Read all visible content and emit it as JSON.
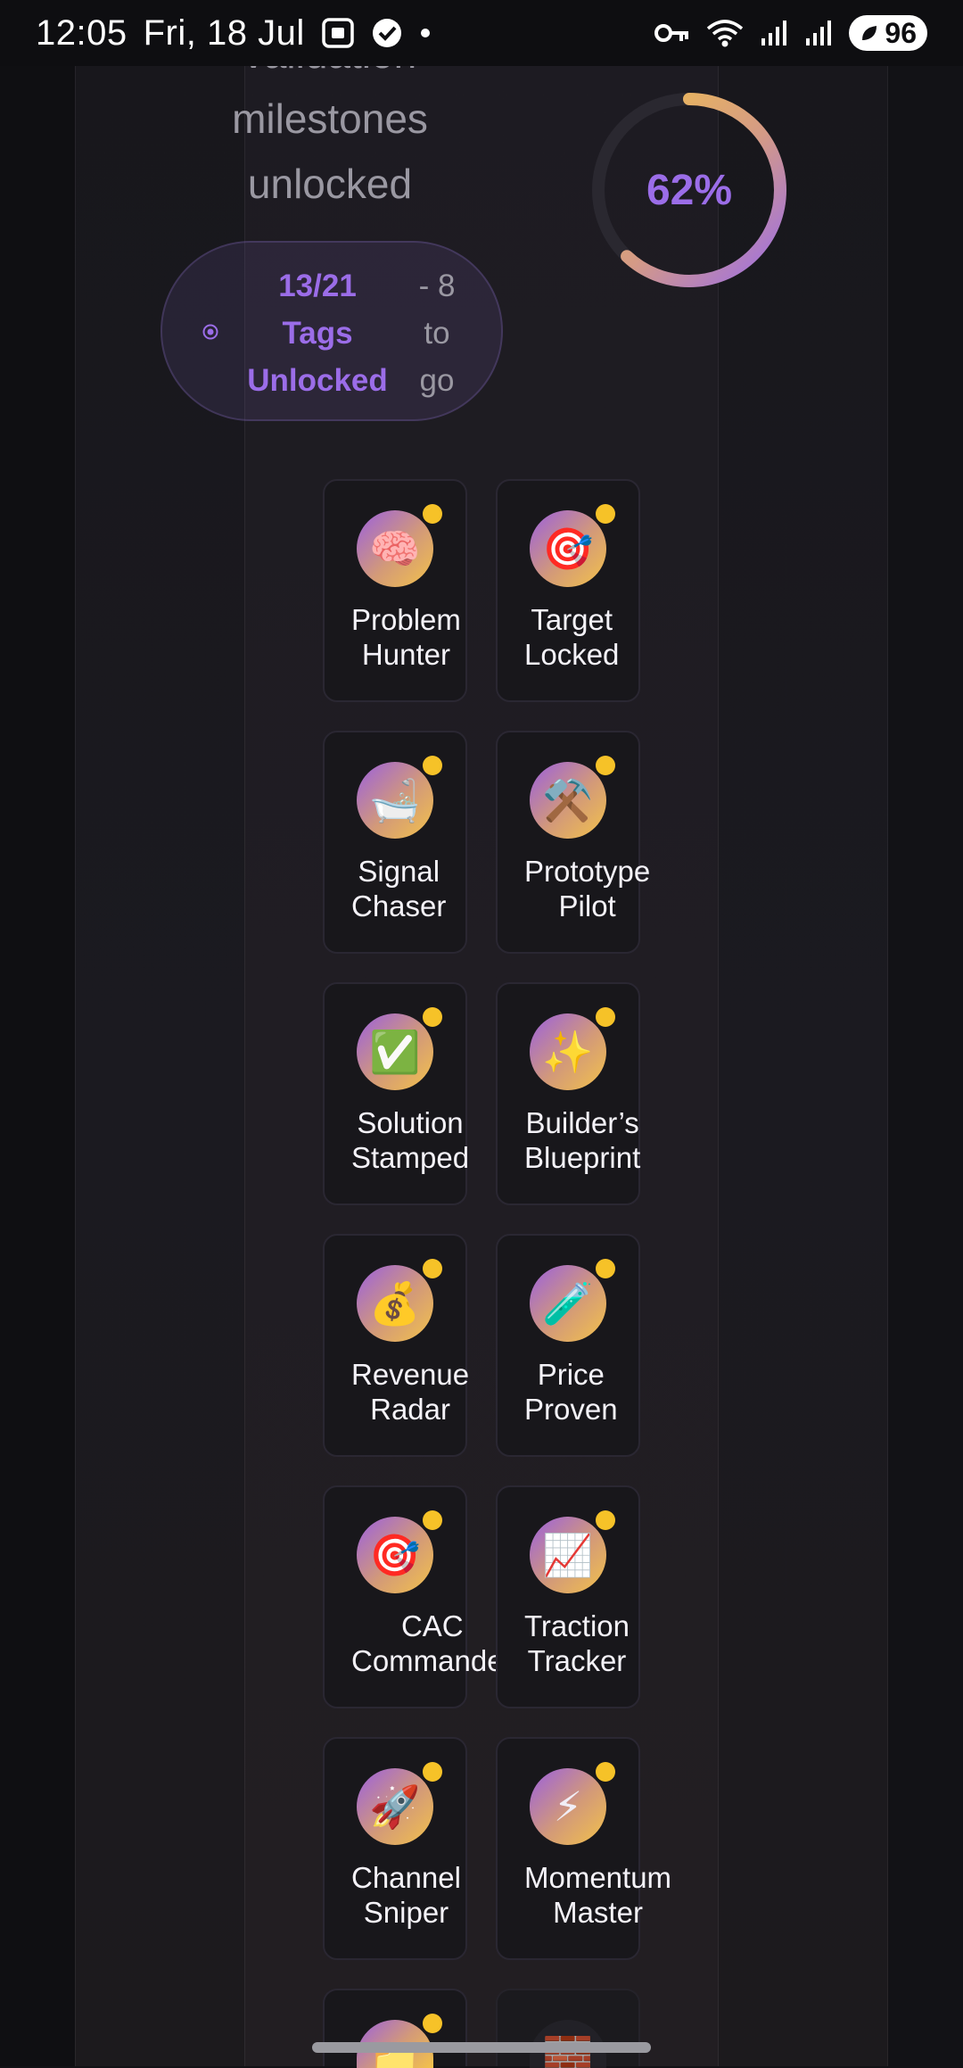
{
  "status_bar": {
    "time": "12:05",
    "date": "Fri, 18 Jul",
    "battery": "96",
    "icons": [
      "screenshot-icon",
      "check-badge-icon",
      "dot-icon",
      "vpn-key-icon",
      "wifi-icon",
      "signal-icon",
      "signal-icon-2",
      "battery-icon"
    ]
  },
  "header": {
    "caption_lines": [
      "validation",
      "milestones",
      "unlocked"
    ],
    "progress_percent": "62%",
    "progress_fraction": 0.62
  },
  "tags_summary": {
    "count_lines": [
      "13/21",
      "Tags",
      "Unlocked"
    ],
    "remaining_lines": [
      "- 8",
      "to",
      "go"
    ]
  },
  "badges": [
    {
      "emoji": "🧠",
      "icon_name": "brain-icon",
      "lines": [
        "Problem",
        "Hunter"
      ],
      "unlocked": true
    },
    {
      "emoji": "🎯",
      "icon_name": "target-icon",
      "lines": [
        "Target",
        "Locked"
      ],
      "unlocked": true
    },
    {
      "emoji": "🛁",
      "icon_name": "bathtub-icon",
      "lines": [
        "Signal",
        "Chaser"
      ],
      "unlocked": true
    },
    {
      "emoji": "⚒️",
      "icon_name": "tools-icon",
      "lines": [
        "Prototype",
        "Pilot"
      ],
      "unlocked": true
    },
    {
      "emoji": "✅",
      "icon_name": "check-mark-icon",
      "lines": [
        "Solution",
        "Stamped"
      ],
      "unlocked": true
    },
    {
      "emoji": "✨",
      "icon_name": "sparkles-icon",
      "lines": [
        "Builder’s",
        "Blueprint"
      ],
      "unlocked": true
    },
    {
      "emoji": "💰",
      "icon_name": "money-bag-icon",
      "lines": [
        "Revenue",
        "Radar"
      ],
      "unlocked": true
    },
    {
      "emoji": "🧪",
      "icon_name": "test-tube-icon",
      "lines": [
        "Price",
        "Proven"
      ],
      "unlocked": true
    },
    {
      "emoji": "🎯",
      "icon_name": "target-icon",
      "lines": [
        "CAC",
        "Commander"
      ],
      "unlocked": true
    },
    {
      "emoji": "📈",
      "icon_name": "chart-up-icon",
      "lines": [
        "Traction",
        "Tracker"
      ],
      "unlocked": true
    },
    {
      "emoji": "🚀",
      "icon_name": "rocket-icon",
      "lines": [
        "Channel",
        "Sniper"
      ],
      "unlocked": true
    },
    {
      "emoji": "⚡",
      "icon_name": "lightning-icon",
      "lines": [
        "Momentum",
        "Master"
      ],
      "unlocked": true
    },
    {
      "emoji": "📁",
      "icon_name": "folder-icon",
      "lines": [],
      "unlocked": true
    },
    {
      "emoji": "🧱",
      "icon_name": "brick-icon",
      "lines": [],
      "unlocked": false
    }
  ],
  "colors": {
    "accent_purple": "#9b6de8",
    "accent_gold": "#f3c24a",
    "status_dot": "#f6c228",
    "card_border": "#2a2732",
    "background": "#121216"
  }
}
